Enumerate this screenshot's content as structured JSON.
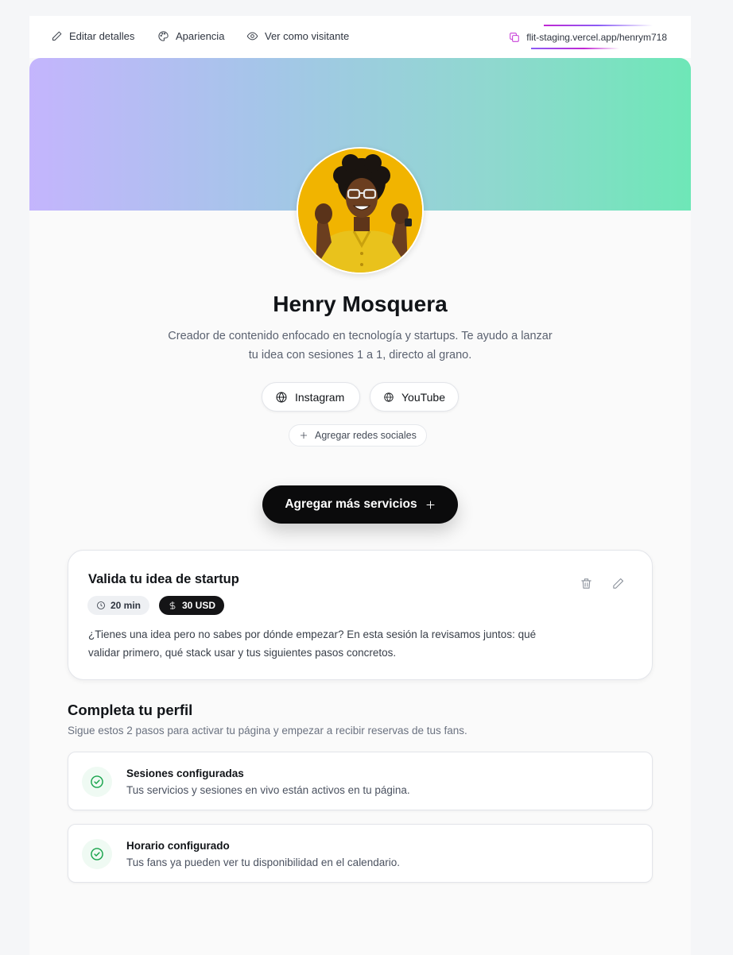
{
  "toolbar": {
    "edit_label": "Editar detalles",
    "appearance_label": "Apariencia",
    "view_label": "Ver como visitante",
    "url": "flit-staging.vercel.app/henrym718"
  },
  "profile": {
    "name": "Henry Mosquera",
    "bio_line1": "Creador de contenido enfocado en tecnología y startups. Te ayudo a lanzar",
    "bio_line2": "tu idea con sesiones 1 a 1, directo al grano."
  },
  "social": {
    "links": [
      {
        "label": "Instagram",
        "icon": "globe-icon"
      },
      {
        "label": "YouTube",
        "icon": "globe-icon"
      }
    ],
    "add_label": "Agregar redes sociales"
  },
  "cta": {
    "label": "Agregar más servicios"
  },
  "service": {
    "title": "Valida tu idea de startup",
    "duration": "20 min",
    "price": "30 USD",
    "description_line1": "¿Tienes una idea pero no sabes por dónde empezar? En esta sesión la revisamos juntos: qué",
    "description_line2": "validar primero, qué stack usar y tus siguientes pasos concretos."
  },
  "complete_profile": {
    "title": "Completa tu perfil",
    "subtitle": "Sigue estos 2 pasos para activar tu página y empezar a recibir reservas de tus fans.",
    "steps": [
      {
        "title": "Sesiones configuradas",
        "description": "Tus servicios y sesiones en vivo están activos en tu página."
      },
      {
        "title": "Horario configurado",
        "description": "Tus fans ya pueden ver tu disponibilidad en el calendario."
      }
    ]
  },
  "colors": {
    "banner_start": "#c4b5fd",
    "banner_end": "#6ee7b7",
    "accent": "#c026d3",
    "success": "#16a34a",
    "cta_bg": "#0b0b0c"
  }
}
